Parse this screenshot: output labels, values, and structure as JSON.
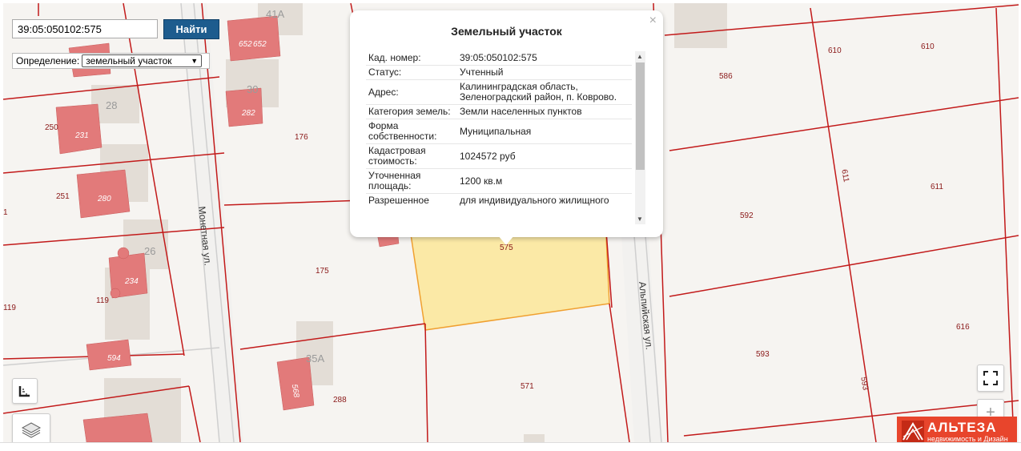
{
  "search": {
    "value": "39:05:050102:575",
    "button_label": "Найти"
  },
  "definition": {
    "label": "Определение:",
    "selected": "земельный участок"
  },
  "popup": {
    "title": "Земельный участок",
    "close": "×",
    "rows": [
      {
        "key": "Кад. номер:",
        "value": "39:05:050102:575"
      },
      {
        "key": "Статус:",
        "value": "Учтенный"
      },
      {
        "key": "Адрес:",
        "value": "Калининградская область, Зеленоградский район, п. Коврово."
      },
      {
        "key": "Категория земель:",
        "value": "Земли населенных пунктов"
      },
      {
        "key": "Форма собственности:",
        "value": "Муниципальная"
      },
      {
        "key": "Кадастровая стоимость:",
        "value": "1024572 руб"
      },
      {
        "key": "Уточненная площадь:",
        "value": "1200 кв.м"
      },
      {
        "key": "Разрешенное",
        "value": "для индивидуального жилищного"
      }
    ]
  },
  "map": {
    "streets": [
      "Монетная ул.",
      "Альпийская ул."
    ],
    "house_numbers": [
      "41А",
      "30",
      "28",
      "26",
      "35А"
    ],
    "building_labels": [
      "652",
      "652",
      "282",
      "231",
      "280",
      "234",
      "594",
      "568"
    ],
    "parcel_labels": [
      "176",
      "250",
      "251",
      "175",
      "119",
      "119",
      "288",
      "575",
      "571",
      "586",
      "610",
      "610",
      "611",
      "611",
      "592",
      "616",
      "593",
      "593",
      "1"
    ],
    "colors": {
      "background": "#f6f4f1",
      "boundary": "#c21a1a",
      "building": "#e27a7a",
      "house": "#e3ddd6",
      "selected_parcel": "#fbe9a6",
      "selected_border": "#f0a030"
    }
  },
  "controls": {
    "ruler": "ruler-icon",
    "layers": "layers-icon",
    "fullscreen": "fullscreen-icon",
    "zoom_in": "+"
  },
  "logo": {
    "name": "АЛЬТЕЗА",
    "tagline": "недвижимость и Дизайн"
  }
}
